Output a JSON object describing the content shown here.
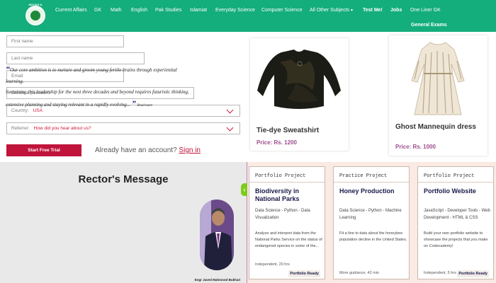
{
  "nav": {
    "logo_text": "MOCKS & PAPERS",
    "items": [
      "Current Affairs",
      "GK",
      "Math",
      "English",
      "Pak Studies",
      "Islamiat",
      "Everyday Science",
      "Computer Science",
      "All Other Subjects",
      "Test Me!",
      "Jobs",
      "One Liner GK"
    ],
    "second_row": "General Exams"
  },
  "form": {
    "first_name": "First name",
    "last_name": "Last name",
    "email": "Email",
    "password": "Create a password",
    "country_label": "Country:",
    "country_value": "USA",
    "referrer_label": "Referrer:",
    "referrer_value": "How did you hear about us?",
    "trial_button": "Start Free Trial",
    "have_account": "Already have an account?",
    "sign_in": "Sign in"
  },
  "products": [
    {
      "name": "Tie-dye Sweatshirt",
      "price": "Price: Rs. 1200"
    },
    {
      "name": "Ghost Mannequin dress",
      "price": "Price: Rs. 1000"
    }
  ],
  "rector": {
    "title": "Rector's Message",
    "quote_l1": "Our core ambition is to nurture and groom young fertile brains through experiential learning.",
    "quote_l2": "Sustaining this leadership for the next three decades and beyond requires futuristic thinking,",
    "quote_l3": "extensive planning and staying relevant in a rapidly evolving...",
    "read_more": "Read more",
    "name": "Engr Javed Mahmood Bukhari"
  },
  "projects": [
    {
      "kind": "Portfolio Project",
      "title": "Biodiversity in National Parks",
      "tags": "Data Science - Python - Data Visualization",
      "desc": "Analyze and interpret data from the National Parks Service on the status of endangered species in some of the...",
      "meta": "Independent, 20 hrs",
      "badge": "Portfolio Ready"
    },
    {
      "kind": "Practice Project",
      "title": "Honey Production",
      "tags": "Data Science - Python - Machine Learning",
      "desc": "Fit a line to data about the honeybee population decline in the United States.",
      "meta": "More guidance, 42 min",
      "badge": ""
    },
    {
      "kind": "Portfolio Project",
      "title": "Portfolio Website",
      "tags": "JavaScript - Developer Tools - Web Development - HTML & CSS",
      "desc": "Build your own portfolio website to showcase the projects that you make on Codecademy!",
      "meta": "Independent, 5 hrs",
      "badge": "Portfolio Ready"
    }
  ],
  "colors": {
    "nav": "#14ad7c",
    "accent": "#c0143b",
    "price": "#9b4d8e",
    "project_bg": "#fbeae3"
  }
}
